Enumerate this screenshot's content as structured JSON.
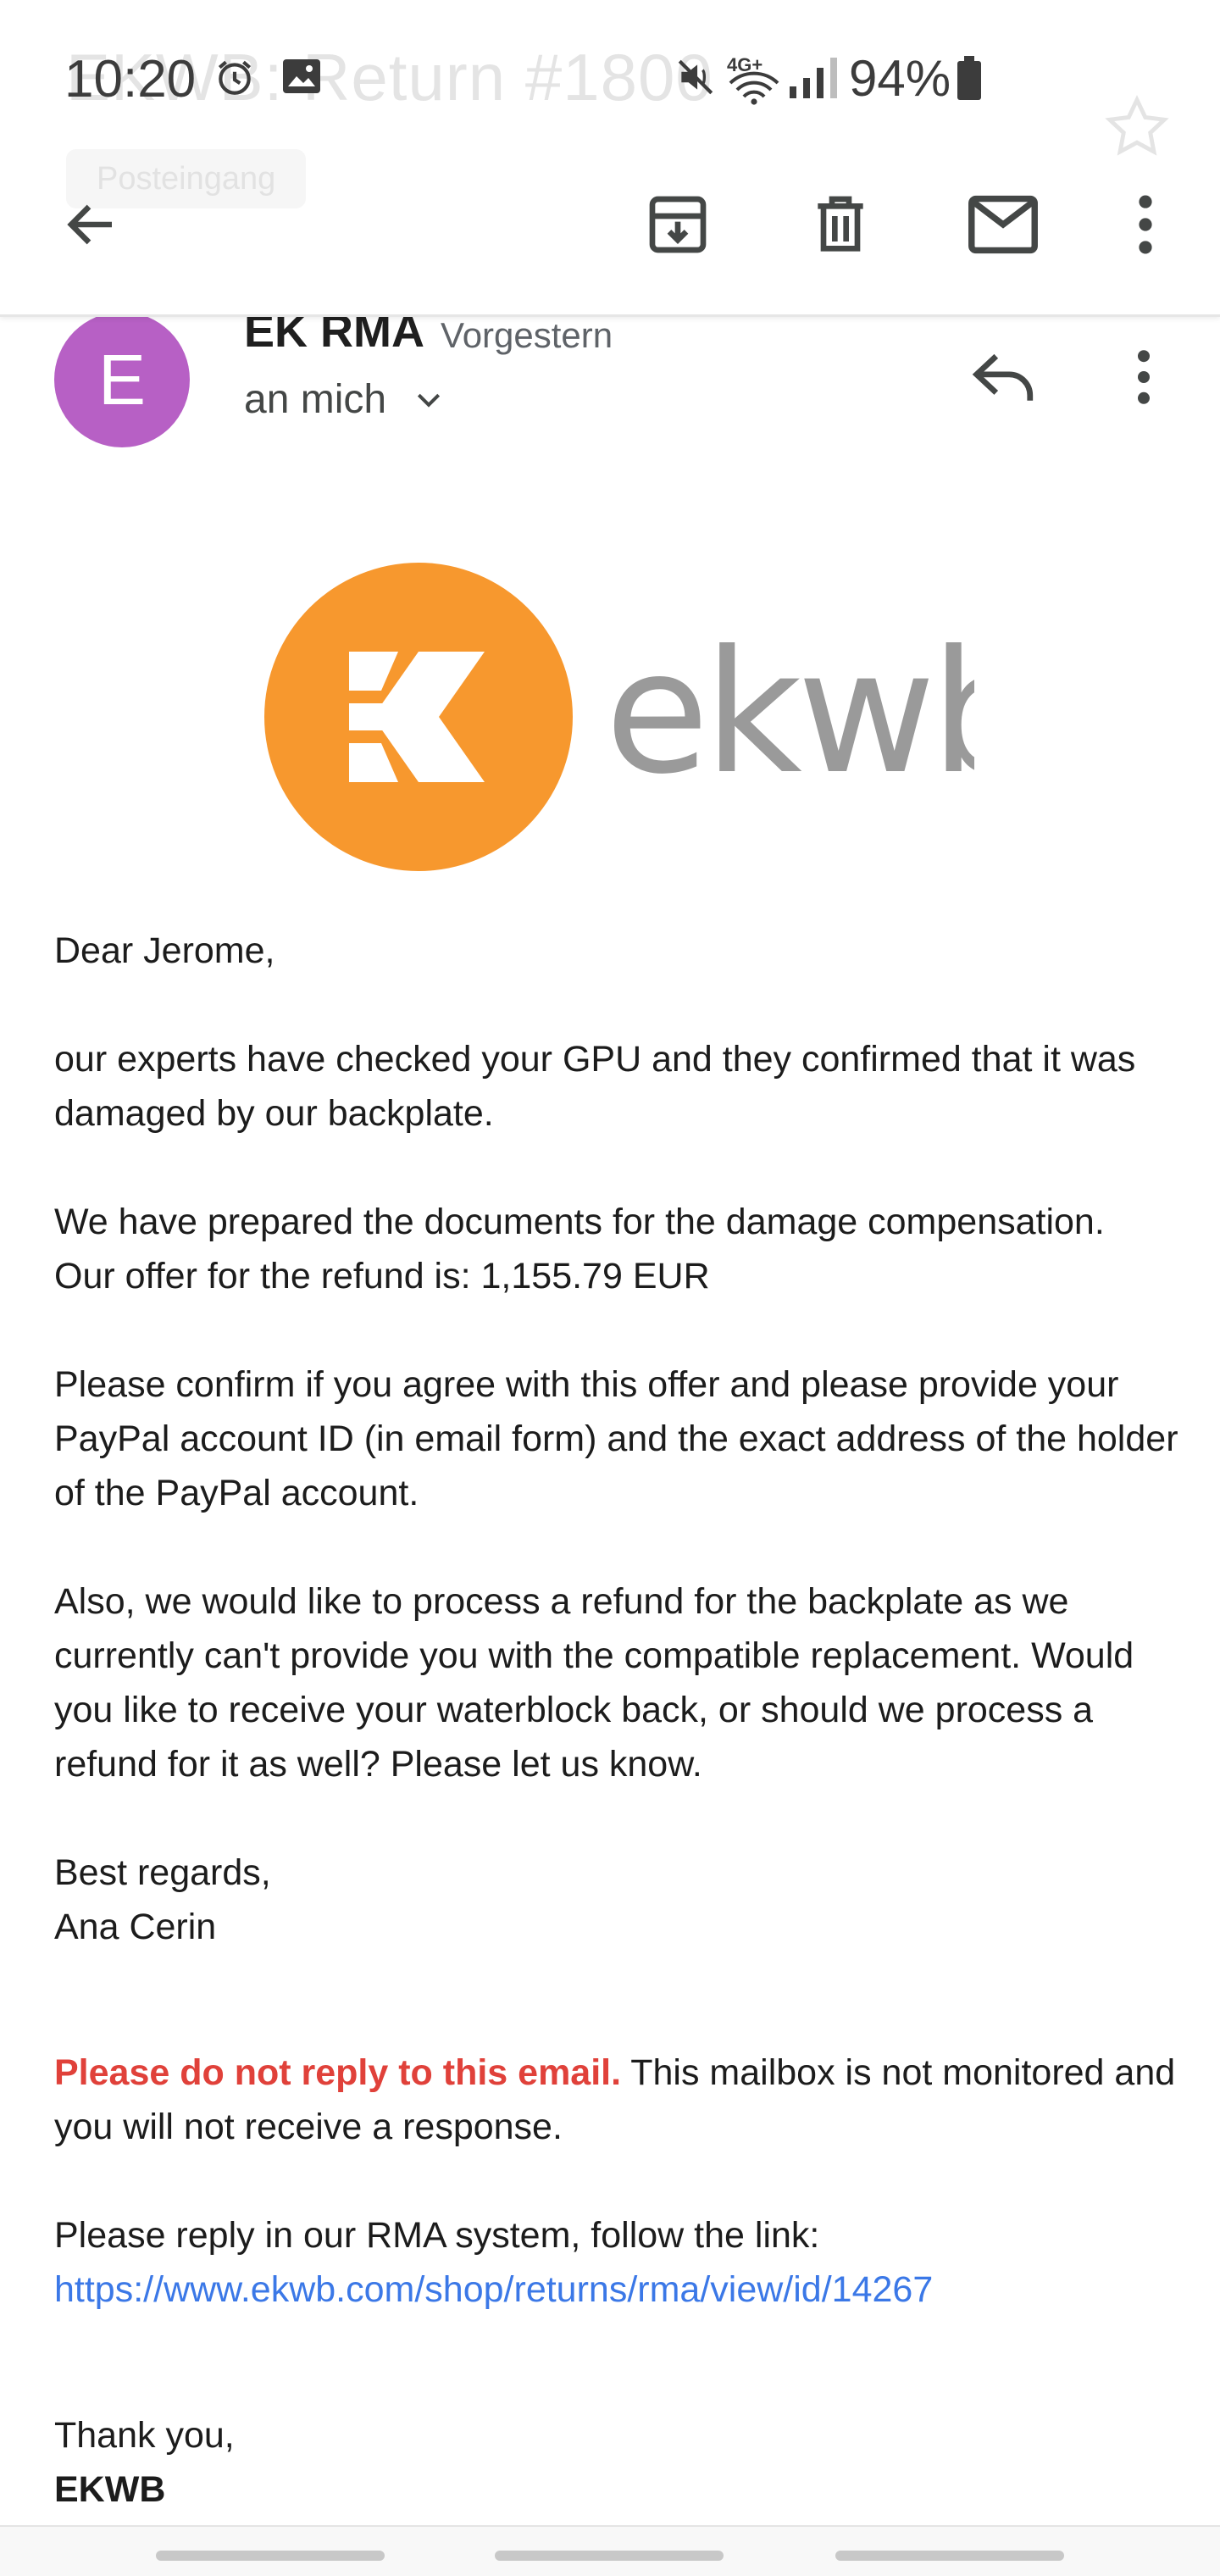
{
  "status_bar": {
    "time": "10:20",
    "battery": "94%",
    "network": "4G+",
    "icons": [
      "alarm-icon",
      "image-icon",
      "mute-icon",
      "wifi-icon",
      "signal-icon",
      "battery-icon"
    ]
  },
  "header_behind": {
    "subject": "EKWB: Return #1800",
    "folder_label": "Posteingang"
  },
  "toolbar": {
    "icons": [
      "back-arrow-icon",
      "archive-icon",
      "delete-icon",
      "mark-unread-icon",
      "more-vert-icon"
    ]
  },
  "message": {
    "avatar_letter": "E",
    "avatar_color": "#b760c5",
    "sender": "EK RMA",
    "date": "Vorgestern",
    "recipient": "an mich",
    "logo_text": "ekwb",
    "logo_color": "#f7982e",
    "greeting": "Dear Jerome,",
    "para1": "our experts have checked your GPU and they confirmed that it was damaged by our backplate.",
    "para2_line1": "We have prepared the documents for the damage compensation.",
    "para2_line2": "Our offer for the refund is: 1,155.79 EUR",
    "para3": "Please confirm if you agree with this offer and please provide your PayPal account ID (in email form) and the exact address of the holder of the PayPal account.",
    "para4": "Also, we would like to process a refund for the backplate as we currently can't provide you with the compatible replacement. Would you like to receive your waterblock back, or should we process a refund for it as well? Please let us know.",
    "regards": "Best regards,",
    "signer": "Ana Cerin",
    "warning_bold": "Please do not reply to this email.",
    "warning_rest": " This mailbox is not monitored and you will not receive a response.",
    "reply_instructions": "Please reply in our RMA system, follow the link:",
    "rma_link": "https://www.ekwb.com/shop/returns/rma/view/id/14267",
    "thanks": "Thank you,",
    "company": "EKWB"
  },
  "colors": {
    "warning": "#e0413a",
    "link": "#3b78e7"
  }
}
